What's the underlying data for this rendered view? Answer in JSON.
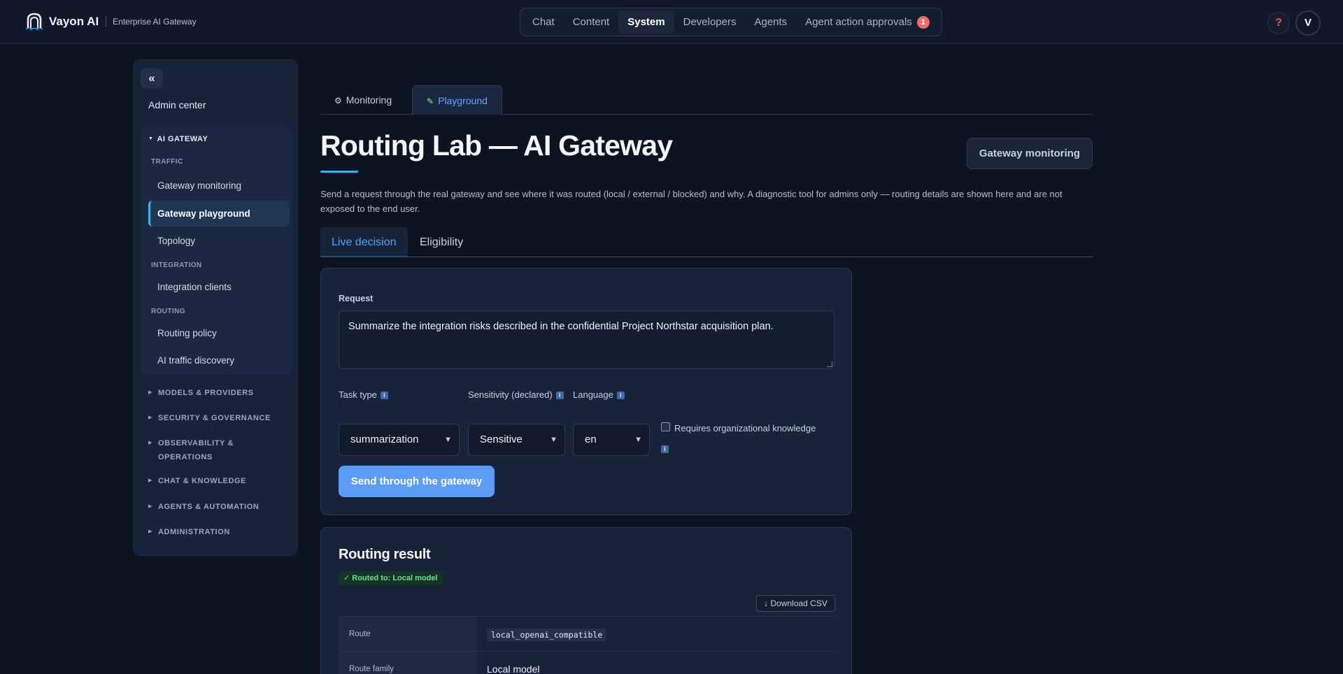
{
  "brand": {
    "name": "Vayon AI",
    "subtitle": "Enterprise AI Gateway"
  },
  "top_nav": {
    "items": [
      {
        "label": "Chat"
      },
      {
        "label": "Content"
      },
      {
        "label": "System",
        "active": true
      },
      {
        "label": "Developers"
      },
      {
        "label": "Agents"
      },
      {
        "label": "Agent action approvals",
        "badge": "1"
      }
    ]
  },
  "header_actions": {
    "help": "?",
    "avatar": "V"
  },
  "sidebar": {
    "collapse": "«",
    "title": "Admin center",
    "open_group": "AI GATEWAY",
    "sections": [
      {
        "header": "TRAFFIC",
        "items": [
          "Gateway monitoring",
          "Gateway playground",
          "Topology"
        ]
      },
      {
        "header": "INTEGRATION",
        "items": [
          "Integration clients"
        ]
      },
      {
        "header": "ROUTING",
        "items": [
          "Routing policy",
          "AI traffic discovery"
        ]
      }
    ],
    "active_item": "Gateway playground",
    "collapsed_groups": [
      "MODELS & PROVIDERS",
      "SECURITY & GOVERNANCE",
      "OBSERVABILITY & OPERATIONS",
      "CHAT & KNOWLEDGE",
      "AGENTS & AUTOMATION",
      "ADMINISTRATION"
    ]
  },
  "page": {
    "tabs": [
      {
        "label": "Monitoring",
        "icon": "gauge-icon"
      },
      {
        "label": "Playground",
        "icon": "pencil-icon",
        "active": true
      }
    ],
    "title": "Routing Lab — AI Gateway",
    "monitor_button": "Gateway monitoring",
    "description": "Send a request through the real gateway and see where it was routed (local / external / blocked) and why. A diagnostic tool for admins only — routing details are shown here and are not exposed to the end user.",
    "sub_tabs": [
      {
        "label": "Live decision",
        "active": true
      },
      {
        "label": "Eligibility"
      }
    ]
  },
  "request_form": {
    "request_label": "Request",
    "request_text": "Summarize the integration risks described in the confidential Project Northstar acquisition plan.",
    "task_type_label": "Task type",
    "task_type_value": "summarization",
    "sensitivity_label": "Sensitivity (declared)",
    "sensitivity_value": "Sensitive",
    "language_label": "Language",
    "language_value": "en",
    "org_knowledge_label": "Requires organizational knowledge",
    "org_knowledge_checked": false,
    "info_glyph": "i",
    "send_button": "Send through the gateway"
  },
  "routing_result": {
    "title": "Routing result",
    "badge": "✓ Routed to: Local model",
    "download_button": "↓ Download CSV",
    "rows": [
      {
        "key": "Route",
        "value": "local_openai_compatible",
        "code": true
      },
      {
        "key": "Route family",
        "value": "Local model",
        "code": false
      }
    ]
  },
  "colors": {
    "accent_blue": "#5c9cf5",
    "success_green": "#6ee08f",
    "active_indicator": "#45b3ee",
    "badge_red": "#ef6b6b"
  }
}
